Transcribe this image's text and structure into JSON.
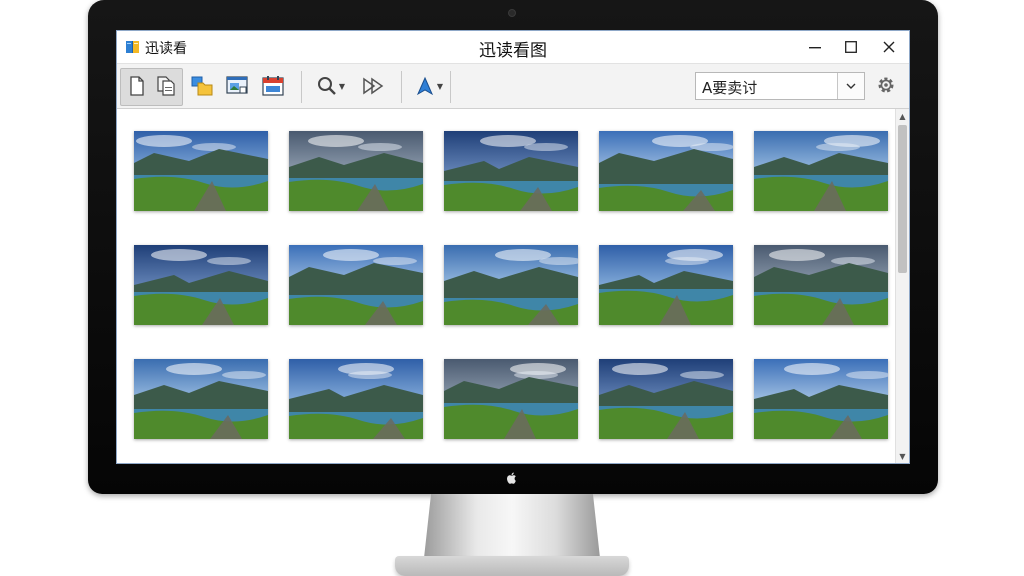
{
  "app": {
    "name": "迅读看",
    "window_title": "迅读看图"
  },
  "toolbar": {
    "buttons": [
      {
        "name": "new-page-button",
        "icon": "page-icon"
      },
      {
        "name": "copy-pages-button",
        "icon": "copy-pages-icon"
      },
      {
        "name": "folders-button",
        "icon": "folders-icon"
      },
      {
        "name": "image-view-button",
        "icon": "image-window-icon"
      },
      {
        "name": "calendar-button",
        "icon": "calendar-icon"
      },
      {
        "name": "zoom-button",
        "icon": "magnifier-icon"
      },
      {
        "name": "slideshow-button",
        "icon": "play-forward-icon"
      },
      {
        "name": "text-tool-button",
        "icon": "pen-tip-icon"
      }
    ],
    "search_combo_value": "A要卖讨"
  },
  "colors": {
    "window_border": "#8fa8c8",
    "toolbar_bg": "#f3f3f3",
    "bezel": "#0a0a0a"
  },
  "gallery": {
    "rows": 3,
    "columns": 5,
    "thumbnails": [
      {
        "scene": "mountain-lake-road"
      },
      {
        "scene": "hill-road-sunset"
      },
      {
        "scene": "rocky-lake-mountains"
      },
      {
        "scene": "lake-cloudy-hills"
      },
      {
        "scene": "river-meadow"
      },
      {
        "scene": "meadow-river-dusk"
      },
      {
        "scene": "sunset-pond-rocks"
      },
      {
        "scene": "lake-rock-path"
      },
      {
        "scene": "sunset-lake-hills"
      },
      {
        "scene": "sea-cliff-coast"
      },
      {
        "scene": "valley-pond"
      },
      {
        "scene": "river-cliff-path"
      },
      {
        "scene": "meadow-stream-sunrise"
      },
      {
        "scene": "coast-rocks"
      },
      {
        "scene": "lake-cliff-evening"
      }
    ]
  }
}
